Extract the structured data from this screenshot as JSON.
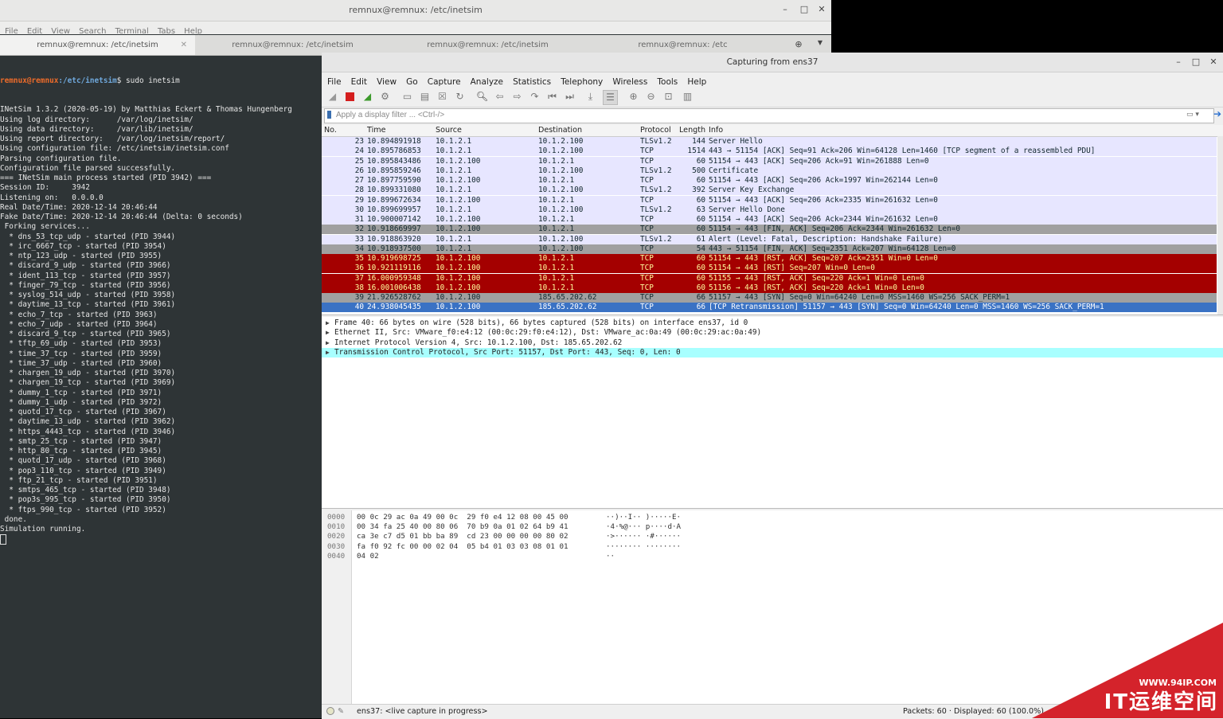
{
  "terminal": {
    "title": "remnux@remnux: /etc/inetsim",
    "menu": [
      "File",
      "Edit",
      "View",
      "Search",
      "Terminal",
      "Tabs",
      "Help"
    ],
    "tabs": [
      "remnux@remnux: /etc/inetsim",
      "remnux@remnux: /etc/inetsim",
      "remnux@remnux: /etc/inetsim",
      "remnux@remnux: /etc"
    ],
    "prompt_user": "remnux@remnux",
    "prompt_path": ":/etc/inetsim",
    "prompt_cmd": "$ sudo inetsim",
    "lines": [
      "INetSim 1.3.2 (2020-05-19) by Matthias Eckert & Thomas Hungenberg",
      "Using log directory:      /var/log/inetsim/",
      "Using data directory:     /var/lib/inetsim/",
      "Using report directory:   /var/log/inetsim/report/",
      "Using configuration file: /etc/inetsim/inetsim.conf",
      "Parsing configuration file.",
      "Configuration file parsed successfully.",
      "=== INetSim main process started (PID 3942) ===",
      "Session ID:     3942",
      "Listening on:   0.0.0.0",
      "Real Date/Time: 2020-12-14 20:46:44",
      "Fake Date/Time: 2020-12-14 20:46:44 (Delta: 0 seconds)",
      " Forking services...",
      "  * dns_53_tcp_udp - started (PID 3944)",
      "  * irc_6667_tcp - started (PID 3954)",
      "  * ntp_123_udp - started (PID 3955)",
      "  * discard_9_udp - started (PID 3966)",
      "  * ident_113_tcp - started (PID 3957)",
      "  * finger_79_tcp - started (PID 3956)",
      "  * syslog_514_udp - started (PID 3958)",
      "  * daytime_13_tcp - started (PID 3961)",
      "  * echo_7_tcp - started (PID 3963)",
      "  * echo_7_udp - started (PID 3964)",
      "  * discard_9_tcp - started (PID 3965)",
      "  * tftp_69_udp - started (PID 3953)",
      "  * time_37_tcp - started (PID 3959)",
      "  * time_37_udp - started (PID 3960)",
      "  * chargen_19_udp - started (PID 3970)",
      "  * chargen_19_tcp - started (PID 3969)",
      "  * dummy_1_tcp - started (PID 3971)",
      "  * dummy_1_udp - started (PID 3972)",
      "  * quotd_17_tcp - started (PID 3967)",
      "  * daytime_13_udp - started (PID 3962)",
      "  * https_4443_tcp - started (PID 3946)",
      "  * smtp_25_tcp - started (PID 3947)",
      "  * http_80_tcp - started (PID 3945)",
      "  * quotd_17_udp - started (PID 3968)",
      "  * pop3_110_tcp - started (PID 3949)",
      "  * ftp_21_tcp - started (PID 3951)",
      "  * smtps_465_tcp - started (PID 3948)",
      "  * pop3s_995_tcp - started (PID 3950)",
      "  * ftps_990_tcp - started (PID 3952)",
      " done.",
      "Simulation running."
    ]
  },
  "wireshark": {
    "title": "Capturing from ens37",
    "menu": [
      "File",
      "Edit",
      "View",
      "Go",
      "Capture",
      "Analyze",
      "Statistics",
      "Telephony",
      "Wireless",
      "Tools",
      "Help"
    ],
    "filter_placeholder": "Apply a display filter ... <Ctrl-/>",
    "columns": [
      "No.",
      "Time",
      "Source",
      "Destination",
      "Protocol",
      "Length",
      "Info"
    ],
    "colors": {
      "tls": "#e7e6ff",
      "tcp": "#e7e6ff",
      "fin": "#a0a0a0",
      "rst": "#a40000",
      "syn": "#a0a0a0",
      "selected": "#3a72c4"
    },
    "packets": [
      {
        "no": "23",
        "time": "10.894891918",
        "src": "10.1.2.1",
        "dst": "10.1.2.100",
        "proto": "TLSv1.2",
        "len": "144",
        "info": "Server Hello",
        "style": "tls"
      },
      {
        "no": "24",
        "time": "10.895786853",
        "src": "10.1.2.1",
        "dst": "10.1.2.100",
        "proto": "TCP",
        "len": "1514",
        "info": "443 → 51154 [ACK] Seq=91 Ack=206 Win=64128 Len=1460 [TCP segment of a reassembled PDU]",
        "style": "tcp"
      },
      {
        "no": "25",
        "time": "10.895843486",
        "src": "10.1.2.100",
        "dst": "10.1.2.1",
        "proto": "TCP",
        "len": "60",
        "info": "51154 → 443 [ACK] Seq=206 Ack=91 Win=261888 Len=0",
        "style": "tcp"
      },
      {
        "no": "26",
        "time": "10.895859246",
        "src": "10.1.2.1",
        "dst": "10.1.2.100",
        "proto": "TLSv1.2",
        "len": "500",
        "info": "Certificate",
        "style": "tls"
      },
      {
        "no": "27",
        "time": "10.897759590",
        "src": "10.1.2.100",
        "dst": "10.1.2.1",
        "proto": "TCP",
        "len": "60",
        "info": "51154 → 443 [ACK] Seq=206 Ack=1997 Win=262144 Len=0",
        "style": "tcp"
      },
      {
        "no": "28",
        "time": "10.899331080",
        "src": "10.1.2.1",
        "dst": "10.1.2.100",
        "proto": "TLSv1.2",
        "len": "392",
        "info": "Server Key Exchange",
        "style": "tls"
      },
      {
        "no": "29",
        "time": "10.899672634",
        "src": "10.1.2.100",
        "dst": "10.1.2.1",
        "proto": "TCP",
        "len": "60",
        "info": "51154 → 443 [ACK] Seq=206 Ack=2335 Win=261632 Len=0",
        "style": "tcp"
      },
      {
        "no": "30",
        "time": "10.899699957",
        "src": "10.1.2.1",
        "dst": "10.1.2.100",
        "proto": "TLSv1.2",
        "len": "63",
        "info": "Server Hello Done",
        "style": "tls"
      },
      {
        "no": "31",
        "time": "10.900007142",
        "src": "10.1.2.100",
        "dst": "10.1.2.1",
        "proto": "TCP",
        "len": "60",
        "info": "51154 → 443 [ACK] Seq=206 Ack=2344 Win=261632 Len=0",
        "style": "tcp"
      },
      {
        "no": "32",
        "time": "10.918669997",
        "src": "10.1.2.100",
        "dst": "10.1.2.1",
        "proto": "TCP",
        "len": "60",
        "info": "51154 → 443 [FIN, ACK] Seq=206 Ack=2344 Win=261632 Len=0",
        "style": "fin"
      },
      {
        "no": "33",
        "time": "10.918863920",
        "src": "10.1.2.1",
        "dst": "10.1.2.100",
        "proto": "TLSv1.2",
        "len": "61",
        "info": "Alert (Level: Fatal, Description: Handshake Failure)",
        "style": "tls"
      },
      {
        "no": "34",
        "time": "10.918937500",
        "src": "10.1.2.1",
        "dst": "10.1.2.100",
        "proto": "TCP",
        "len": "54",
        "info": "443 → 51154 [FIN, ACK] Seq=2351 Ack=207 Win=64128 Len=0",
        "style": "fin"
      },
      {
        "no": "35",
        "time": "10.919698725",
        "src": "10.1.2.100",
        "dst": "10.1.2.1",
        "proto": "TCP",
        "len": "60",
        "info": "51154 → 443 [RST, ACK] Seq=207 Ack=2351 Win=0 Len=0",
        "style": "rst"
      },
      {
        "no": "36",
        "time": "10.921119116",
        "src": "10.1.2.100",
        "dst": "10.1.2.1",
        "proto": "TCP",
        "len": "60",
        "info": "51154 → 443 [RST] Seq=207 Win=0 Len=0",
        "style": "rst"
      },
      {
        "no": "37",
        "time": "16.000959348",
        "src": "10.1.2.100",
        "dst": "10.1.2.1",
        "proto": "TCP",
        "len": "60",
        "info": "51155 → 443 [RST, ACK] Seq=220 Ack=1 Win=0 Len=0",
        "style": "rst"
      },
      {
        "no": "38",
        "time": "16.001006438",
        "src": "10.1.2.100",
        "dst": "10.1.2.1",
        "proto": "TCP",
        "len": "60",
        "info": "51156 → 443 [RST, ACK] Seq=220 Ack=1 Win=0 Len=0",
        "style": "rst"
      },
      {
        "no": "39",
        "time": "21.926528762",
        "src": "10.1.2.100",
        "dst": "185.65.202.62",
        "proto": "TCP",
        "len": "66",
        "info": "51157 → 443 [SYN] Seq=0 Win=64240 Len=0 MSS=1460 WS=256 SACK_PERM=1",
        "style": "syn"
      },
      {
        "no": "40",
        "time": "24.938045435",
        "src": "10.1.2.100",
        "dst": "185.65.202.62",
        "proto": "TCP",
        "len": "66",
        "info": "[TCP Retransmission] 51157 → 443 [SYN] Seq=0 Win=64240 Len=0 MSS=1460 WS=256 SACK_PERM=1",
        "style": "selected"
      }
    ],
    "details": [
      "Frame 40: 66 bytes on wire (528 bits), 66 bytes captured (528 bits) on interface ens37, id 0",
      "Ethernet II, Src: VMware_f0:e4:12 (00:0c:29:f0:e4:12), Dst: VMware_ac:0a:49 (00:0c:29:ac:0a:49)",
      "Internet Protocol Version 4, Src: 10.1.2.100, Dst: 185.65.202.62",
      "Transmission Control Protocol, Src Port: 51157, Dst Port: 443, Seq: 0, Len: 0"
    ],
    "bytes": [
      {
        "off": "0000",
        "hex": "00 0c 29 ac 0a 49 00 0c  29 f0 e4 12 08 00 45 00",
        "ascii": "··)··I·· )·····E·"
      },
      {
        "off": "0010",
        "hex": "00 34 fa 25 40 00 80 06  70 b9 0a 01 02 64 b9 41",
        "ascii": "·4·%@··· p····d·A"
      },
      {
        "off": "0020",
        "hex": "ca 3e c7 d5 01 bb ba 89  cd 23 00 00 00 00 80 02",
        "ascii": "·>······ ·#······"
      },
      {
        "off": "0030",
        "hex": "fa f0 92 fc 00 00 02 04  05 b4 01 03 03 08 01 01",
        "ascii": "········ ········"
      },
      {
        "off": "0040",
        "hex": "04 02",
        "ascii": "··"
      }
    ],
    "status_left": "ens37: <live capture in progress>",
    "status_right": "Packets: 60 · Displayed: 60 (100.0%)"
  },
  "watermark": {
    "url": "WWW.94IP.COM",
    "name": "IT运维空间"
  }
}
